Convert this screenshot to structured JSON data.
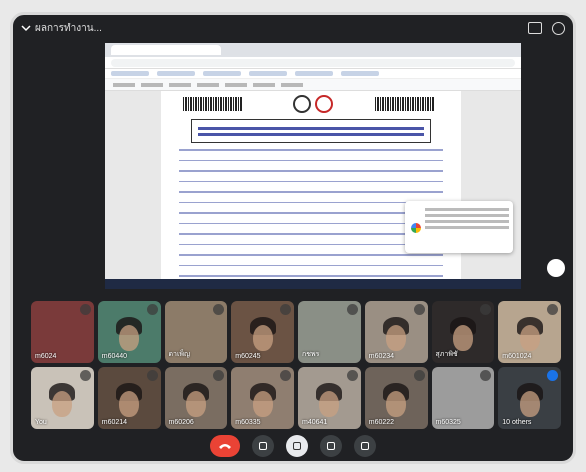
{
  "meeting": {
    "top_label": "ผลการทำงาน..."
  },
  "participants": [
    {
      "label": "m6024",
      "bg": "#7a3a3a",
      "person": false
    },
    {
      "label": "m60440",
      "bg": "#4c7b6a",
      "person": true
    },
    {
      "label": "ดาเพ็ญ",
      "bg": "#8c7b68",
      "person": false
    },
    {
      "label": "m60245",
      "bg": "#6b5344",
      "person": true
    },
    {
      "label": "กชพร",
      "bg": "#8a8f86",
      "person": false
    },
    {
      "label": "m60234",
      "bg": "#9a8f83",
      "person": true
    },
    {
      "label": "สุภาพิชั",
      "bg": "#2e2a2a",
      "person": true
    },
    {
      "label": "m601024",
      "bg": "#b7a58f",
      "person": true
    },
    {
      "label": "You",
      "bg": "#c9c2b8",
      "person": true
    },
    {
      "label": "m60214",
      "bg": "#5b4a3e",
      "person": true
    },
    {
      "label": "m60206",
      "bg": "#7a6d61",
      "person": true
    },
    {
      "label": "m60335",
      "bg": "#8f7e70",
      "person": true
    },
    {
      "label": "m40641",
      "bg": "#a39a90",
      "person": true
    },
    {
      "label": "m60222",
      "bg": "#6e635a",
      "person": true
    },
    {
      "label": "m60325",
      "bg": "#9c9c9c",
      "person": false
    },
    {
      "label": "10 others",
      "bg": "#3a3f44",
      "person": true
    }
  ],
  "controls": [
    "end-call",
    "camera",
    "mic",
    "raise-hand",
    "more"
  ]
}
